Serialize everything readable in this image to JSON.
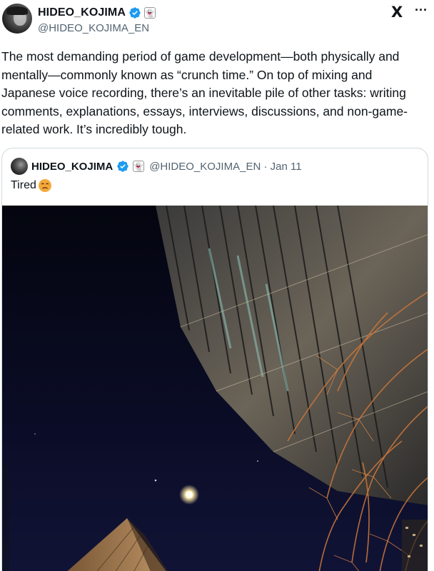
{
  "author": {
    "display_name": "HIDEO_KOJIMA",
    "handle": "@HIDEO_KOJIMA_EN",
    "affiliate_badge": "👻"
  },
  "icons": {
    "verified": "verified-badge-icon",
    "x_logo": "x-logo-icon",
    "more": "more-options-icon",
    "emoji": "tired-face-emoji-icon"
  },
  "x_logo_glyph": "X",
  "more_glyph": "···",
  "tweet": {
    "text": "The most demanding period of game development—both physically and mentally—commonly known as “crunch time.” On top of mixing and Japanese voice recording, there’s an inevitable pile of other tasks: writing comments, explanations, essays, interviews, discussions, and non-game-related work. It’s incredibly tough."
  },
  "quoted_tweet": {
    "display_name": "HIDEO_KOJIMA",
    "handle_date": "@HIDEO_KOJIMA_EN · Jan 11",
    "text": "Tired"
  },
  "colors": {
    "verified_blue": "#1d9bf0",
    "secondary_text": "#536471",
    "border": "#cfd9de",
    "night_sky": "#07091a"
  }
}
